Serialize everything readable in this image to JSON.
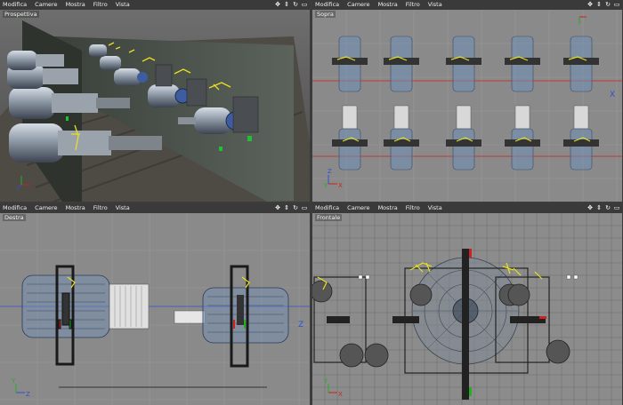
{
  "menu": [
    "Modifica",
    "Camere",
    "Mostra",
    "Filtro",
    "Vista"
  ],
  "nav_icons": [
    "move-view-icon",
    "zoom-view-icon",
    "rotate-view-icon",
    "maximize-view-icon"
  ],
  "viewports": {
    "perspective": {
      "label": "Prospettiva"
    },
    "top": {
      "label": "Sopra"
    },
    "right": {
      "label": "Destra"
    },
    "front": {
      "label": "Frontale"
    }
  },
  "axes": {
    "x": "X",
    "y": "Y",
    "z": "Z"
  },
  "colors": {
    "panel_header": "#3a3a3a",
    "viewport_bg": "#8a8a8a",
    "selection_yellow": "#e8e020",
    "axis_red": "#d02020",
    "axis_green": "#20b020",
    "axis_blue": "#3050d0"
  }
}
